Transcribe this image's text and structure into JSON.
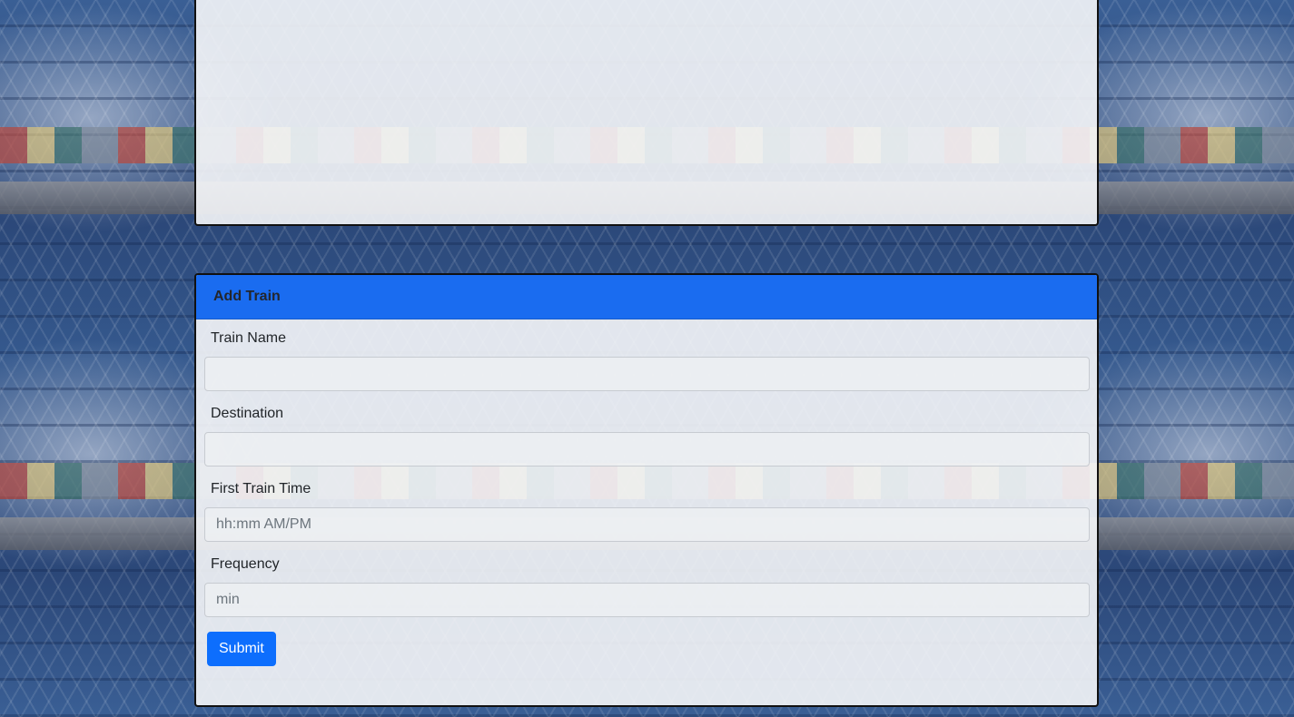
{
  "form": {
    "header_title": "Add Train",
    "fields": [
      {
        "label": "Train Name",
        "value": "",
        "placeholder": ""
      },
      {
        "label": "Destination",
        "value": "",
        "placeholder": ""
      },
      {
        "label": "First Train Time",
        "value": "",
        "placeholder": "hh:mm AM/PM"
      },
      {
        "label": "Frequency",
        "value": "",
        "placeholder": "min"
      }
    ],
    "submit_label": "Submit"
  },
  "colors": {
    "header_background": "#1a6cf0",
    "submit_button": "#0d6efd"
  }
}
